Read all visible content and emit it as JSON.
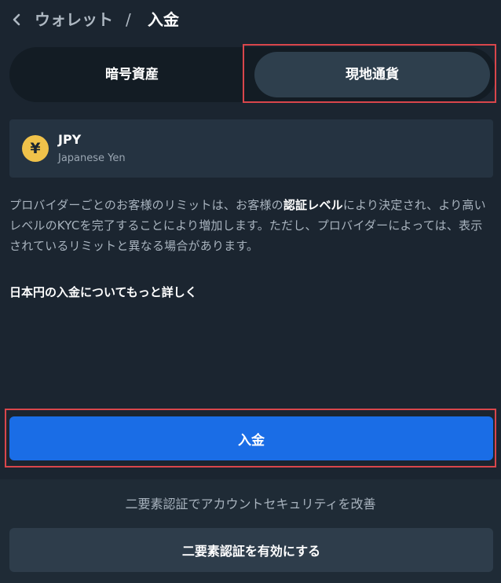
{
  "header": {
    "parent": "ウォレット",
    "separator": "/",
    "current": "入金"
  },
  "tabs": [
    {
      "label": "暗号資産",
      "selected": false
    },
    {
      "label": "現地通貨",
      "selected": true
    }
  ],
  "currency": {
    "symbol": "¥",
    "code": "JPY",
    "name": "Japanese Yen",
    "icon_color": "#f0c24a"
  },
  "info": {
    "before": "プロバイダーごとのお客様のリミットは、お客様の",
    "link": "認証レベル",
    "after": "により決定され、より高いレベルのKYCを完了することにより増加します。ただし、プロバイダーによっては、表示されているリミットと異なる場合があります。"
  },
  "learn_more": "日本円の入金についてもっと詳しく",
  "deposit_button": "入金",
  "twofa": {
    "message": "二要素認証でアカウントセキュリティを改善",
    "button": "二要素認証を有効にする"
  },
  "colors": {
    "background": "#1b2530",
    "primary": "#1a6de6",
    "highlight": "#d9464b"
  }
}
